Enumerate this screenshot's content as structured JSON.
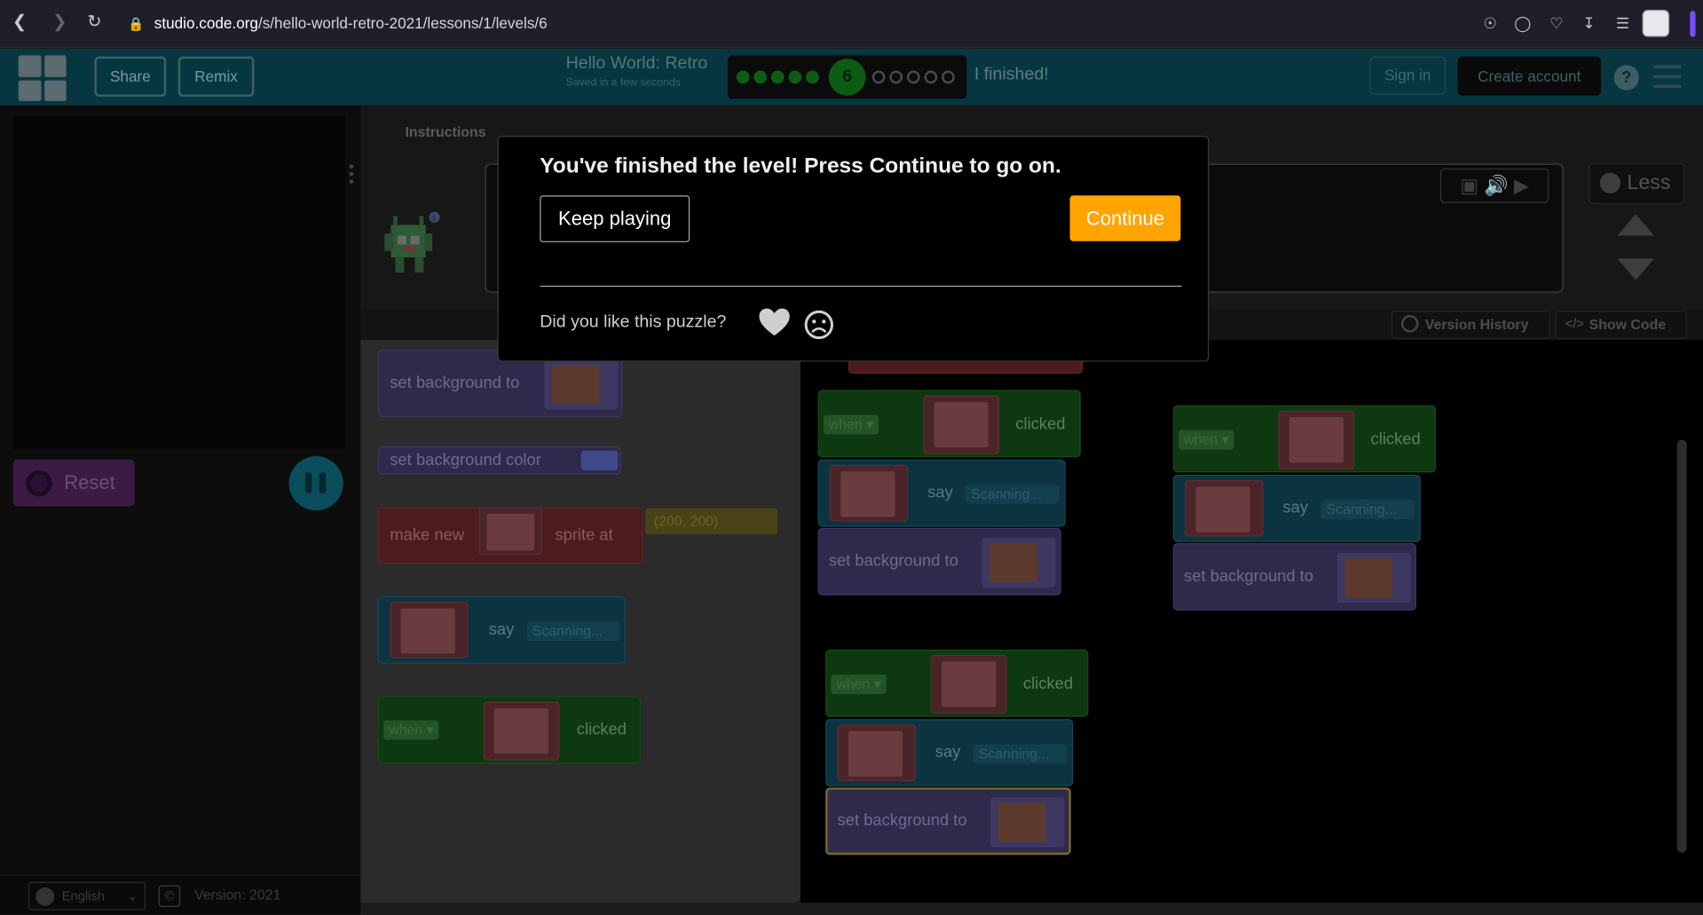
{
  "browser": {
    "url_host": "studio.code.org",
    "url_path": "/s/hello-world-retro-2021/lessons/1/levels/6"
  },
  "header": {
    "share_label": "Share",
    "remix_label": "Remix",
    "project_title": "Hello World: Retro",
    "saved_status": "Saved in a few seconds",
    "progress": {
      "current_level": "6",
      "completed_before": 5,
      "remaining_after": 5
    },
    "finished_label": "I finished!",
    "sign_in_label": "Sign in",
    "create_account_label": "Create account",
    "help_label": "?"
  },
  "left_panel": {
    "reset_label": "Reset",
    "language": "English",
    "version": "Version: 2021"
  },
  "instructions": {
    "tab_label": "Instructions",
    "less_label": "Less",
    "badge_count": "1"
  },
  "workspace": {
    "version_history_label": "Version History",
    "show_code_label": "Show Code"
  },
  "toolbox": {
    "blocks": {
      "set_background": "set background to",
      "set_background_color": "set background color",
      "make_new": "make new",
      "sprite_at": "sprite at",
      "sprite_at_value": "(200, 200)",
      "say": "say",
      "say_value": "Scanning...",
      "when": "when",
      "clicked": "clicked"
    }
  },
  "script_blocks": {
    "when": "when",
    "clicked": "clicked",
    "say": "say",
    "say_value": "Scanning...",
    "set_background": "set background to"
  },
  "modal": {
    "title": "You've finished the level! Press Continue to go on.",
    "keep_playing_label": "Keep playing",
    "continue_label": "Continue",
    "feedback_question": "Did you like this puzzle?"
  },
  "colors": {
    "continue": "#ffa400",
    "header_bg": "#063740",
    "progress_done": "#0d5c14"
  }
}
